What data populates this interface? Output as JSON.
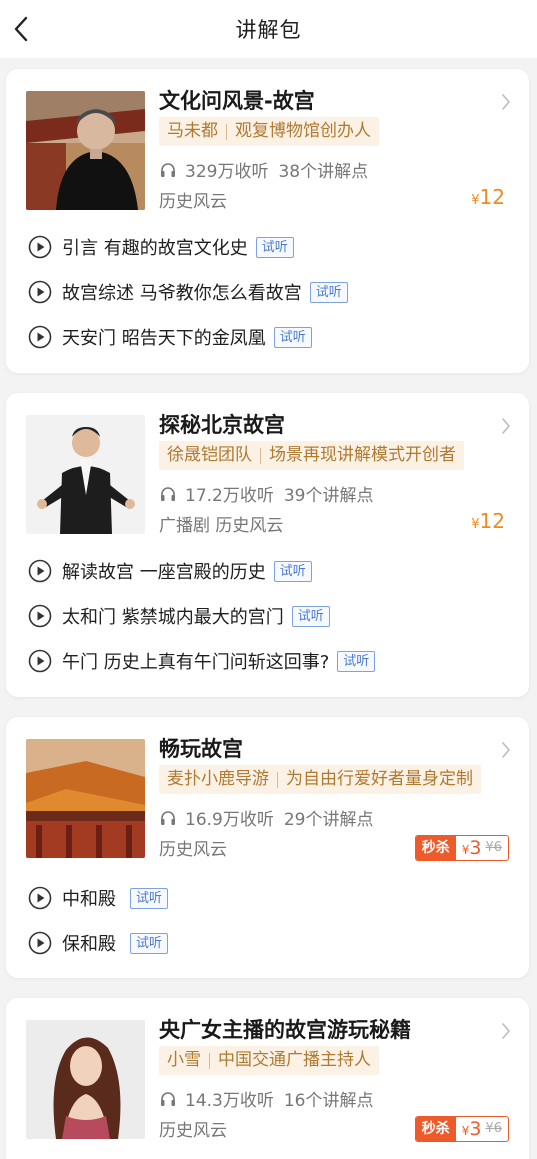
{
  "header": {
    "title": "讲解包",
    "back_icon": "chevron-left-icon"
  },
  "colors": {
    "accent": "#f08a1c",
    "sale": "#ef5a2a",
    "tag_bg": "#fbf1e4",
    "tag_text": "#b07a33",
    "link": "#4a7bd0"
  },
  "packages": [
    {
      "title": "文化问风景-故宫",
      "author": "马未都",
      "author_desc": "观复博物馆创办人",
      "listens": "329万收听",
      "points": "38个讲解点",
      "categories": "历史风云",
      "price_symbol": "¥",
      "price": "12",
      "episodes": [
        {
          "text": "引言  有趣的故宫文化史",
          "tag": "试听"
        },
        {
          "text": "故宫综述  马爷教你怎么看故宫",
          "tag": "试听"
        },
        {
          "text": "天安门  昭告天下的金凤凰",
          "tag": "试听"
        }
      ]
    },
    {
      "title": "探秘北京故宫",
      "author": "徐晟铠团队",
      "author_desc": "场景再现讲解模式开创者",
      "listens": "17.2万收听",
      "points": "39个讲解点",
      "categories": "广播剧  历史风云",
      "price_symbol": "¥",
      "price": "12",
      "episodes": [
        {
          "text": "解读故宫  一座宫殿的历史",
          "tag": "试听"
        },
        {
          "text": "太和门  紫禁城内最大的宫门",
          "tag": "试听"
        },
        {
          "text": "午门  历史上真有午门问斩这回事?",
          "tag": "试听"
        }
      ]
    },
    {
      "title": "畅玩故宫",
      "author": "麦扑小鹿导游",
      "author_desc": "为自由行爱好者量身定制",
      "listens": "16.9万收听",
      "points": "29个讲解点",
      "categories": "历史风云",
      "sale_label": "秒杀",
      "price_symbol": "¥",
      "price": "3",
      "original_price": "¥6",
      "episodes": [
        {
          "text": "中和殿",
          "tag": "试听"
        },
        {
          "text": "保和殿",
          "tag": "试听"
        }
      ]
    },
    {
      "title": "央广女主播的故宫游玩秘籍",
      "author": "小雪",
      "author_desc": "中国交通广播主持人",
      "listens": "14.3万收听",
      "points": "16个讲解点",
      "categories": "历史风云",
      "sale_label": "秒杀",
      "price_symbol": "¥",
      "price": "3",
      "original_price": "¥6"
    }
  ]
}
